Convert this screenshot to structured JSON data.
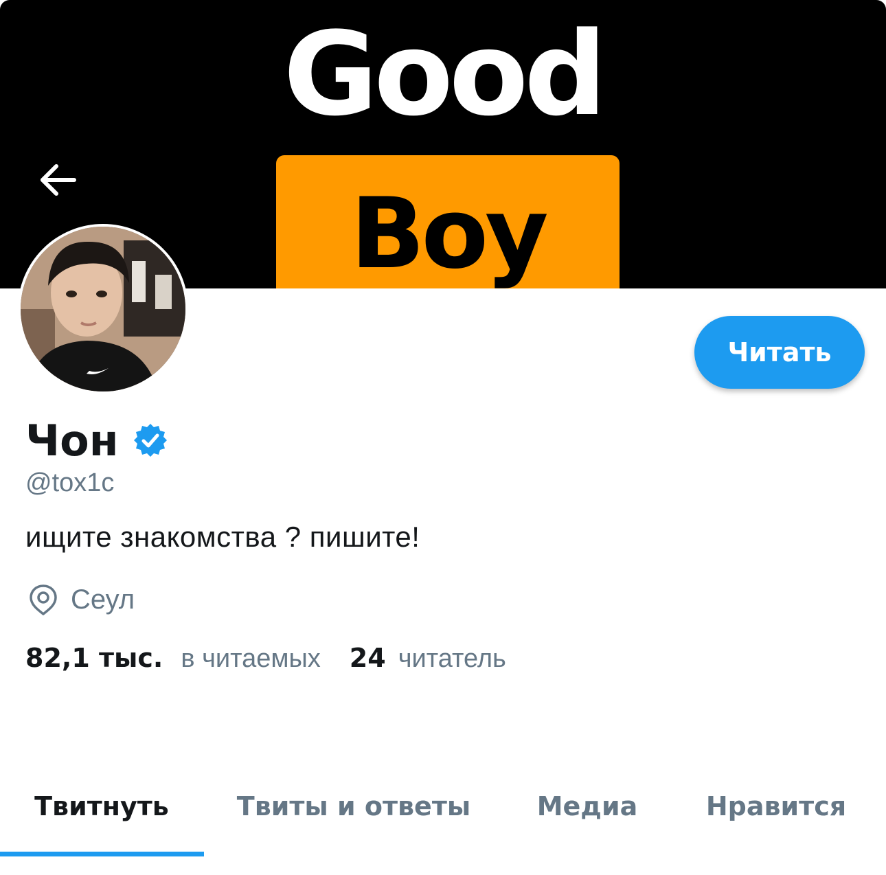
{
  "banner": {
    "text_top": "Good",
    "text_bottom": "Boy",
    "background_color": "#000000",
    "box_color": "#ff9a00"
  },
  "header": {
    "back_icon": "arrow-left-icon"
  },
  "profile": {
    "display_name": "Чон",
    "verified_icon": "verified-badge-icon",
    "handle": "@tox1c",
    "bio": "ищите знакомства ? пишите!",
    "location_icon": "location-pin-icon",
    "location": "Сеул",
    "following_count": "82,1 тыс.",
    "following_label": "в читаемых",
    "followers_count": "24",
    "followers_label": "читатель"
  },
  "actions": {
    "follow_label": "Читать",
    "accent_color": "#1d9bf0"
  },
  "tabs": [
    {
      "label": "Твитнуть",
      "active": true
    },
    {
      "label": "Твиты и ответы",
      "active": false
    },
    {
      "label": "Медиа",
      "active": false
    },
    {
      "label": "Нравится",
      "active": false
    }
  ]
}
